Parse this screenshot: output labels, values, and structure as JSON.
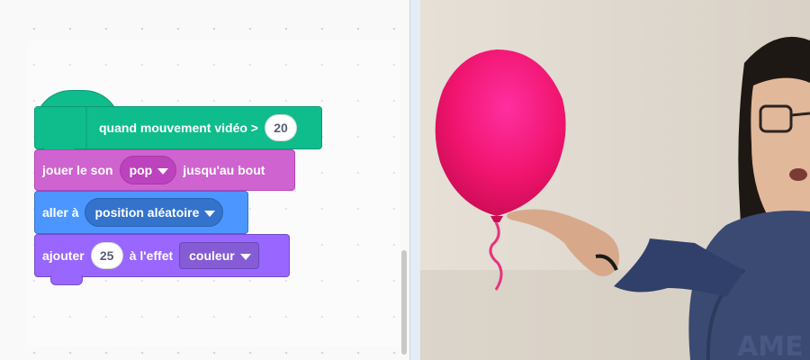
{
  "blocks": {
    "event": {
      "label": "quand mouvement vidéo >",
      "value": "20",
      "color": "#0fbd8c"
    },
    "sound": {
      "label_before": "jouer le son",
      "menu": "pop",
      "label_after": "jusqu'au bout",
      "color": "#cf63cf"
    },
    "motion": {
      "label": "aller à",
      "menu": "position aléatoire",
      "color": "#4c97ff"
    },
    "looks": {
      "label_before": "ajouter",
      "value": "25",
      "label_middle": "à l'effet",
      "menu": "couleur",
      "color": "#9966ff"
    }
  },
  "icons": {
    "dropdown": "caret-down-icon"
  },
  "stage": {
    "balloon_color": "#f0146e",
    "description_icons": [
      "balloon-sprite",
      "webcam-video-feed"
    ]
  }
}
